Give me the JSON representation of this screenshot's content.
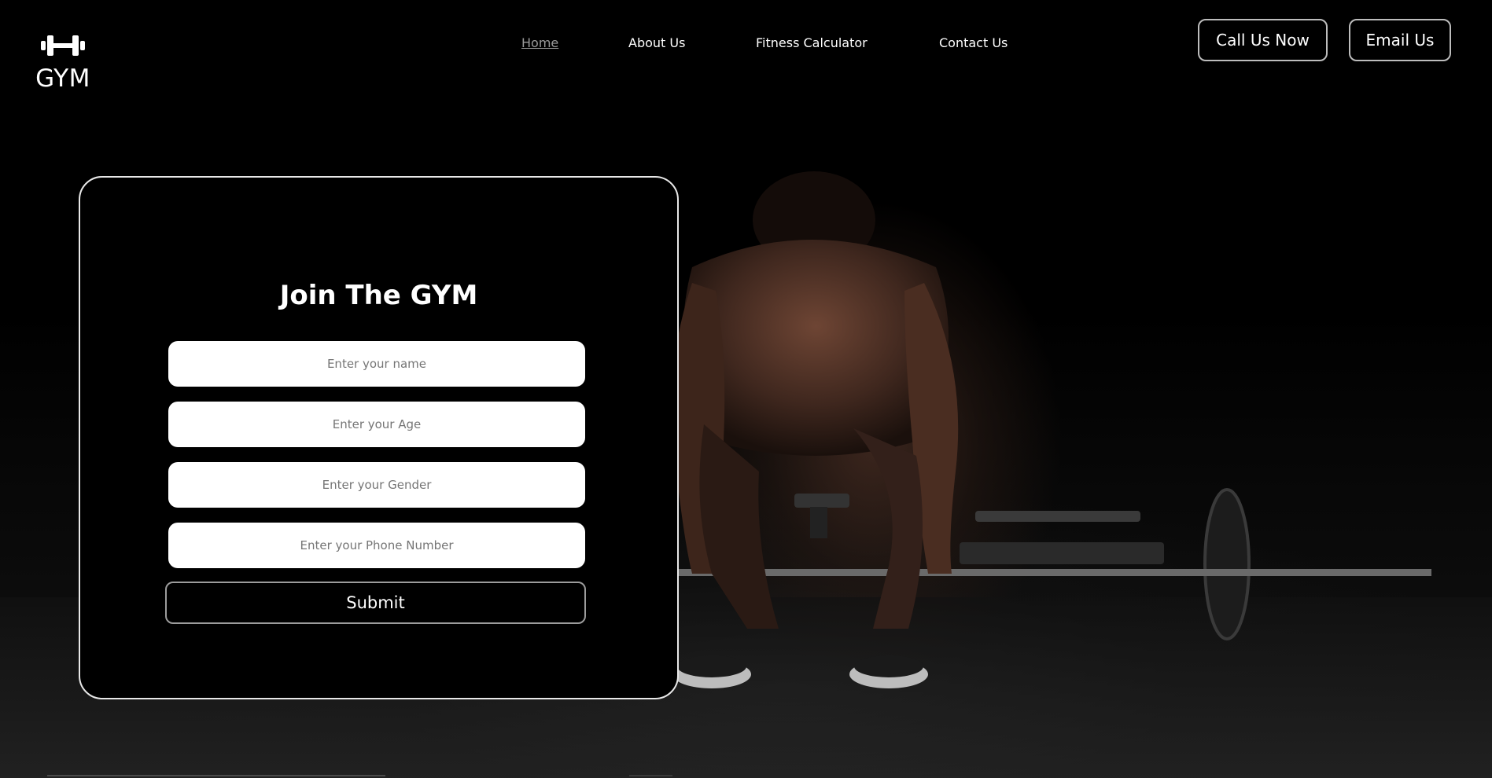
{
  "brand": {
    "logo_icon": "dumbbell-icon",
    "name": "GYM"
  },
  "nav": {
    "items": [
      {
        "label": "Home",
        "active": true
      },
      {
        "label": "About Us"
      },
      {
        "label": "Fitness Calculator"
      },
      {
        "label": "Contact Us"
      }
    ]
  },
  "actions": {
    "call_label": "Call Us Now",
    "email_label": "Email Us"
  },
  "form": {
    "title": "Join The GYM",
    "name_placeholder": "Enter your name",
    "age_placeholder": "Enter your Age",
    "gender_placeholder": "Enter your Gender",
    "phone_placeholder": "Enter your Phone Number",
    "submit_label": "Submit"
  },
  "colors": {
    "background": "#000000",
    "text": "#ffffff",
    "active_nav": "#9a9a9a",
    "field_bg": "#ffffff"
  }
}
